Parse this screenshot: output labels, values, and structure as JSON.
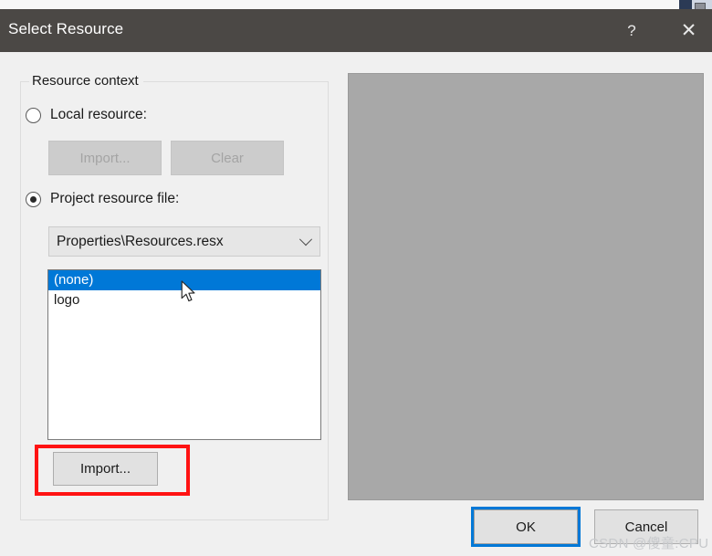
{
  "window": {
    "title": "Select Resource",
    "help_icon": "?",
    "close_icon": "✕"
  },
  "group": {
    "legend": "Resource context"
  },
  "radios": [
    {
      "id": "local",
      "label": "Local resource:",
      "checked": false
    },
    {
      "id": "project",
      "label": "Project resource file:",
      "checked": true
    }
  ],
  "local_buttons": {
    "import_label": "Import...",
    "clear_label": "Clear",
    "enabled": false
  },
  "combo": {
    "value": "Properties\\Resources.resx",
    "arrow_icon": "chevron-down-icon"
  },
  "resource_list": {
    "items": [
      {
        "label": "(none)",
        "selected": true
      },
      {
        "label": "logo",
        "selected": false
      }
    ]
  },
  "import_button": {
    "label": "Import...",
    "highlighted": true
  },
  "preview": {
    "content": "",
    "background_color": "#a8a8a8"
  },
  "footer": {
    "ok_label": "OK",
    "cancel_label": "Cancel",
    "focused_button": "OK"
  },
  "annotation": {
    "color": "#ff1313",
    "target": "import-button"
  },
  "watermark": {
    "text": "CSDN @傻童:CPU"
  },
  "colors": {
    "titlebar": "#4b4845",
    "accent": "#0078d7",
    "dialog_bg": "#f0f0f0",
    "annotation_red": "#ff1313"
  }
}
